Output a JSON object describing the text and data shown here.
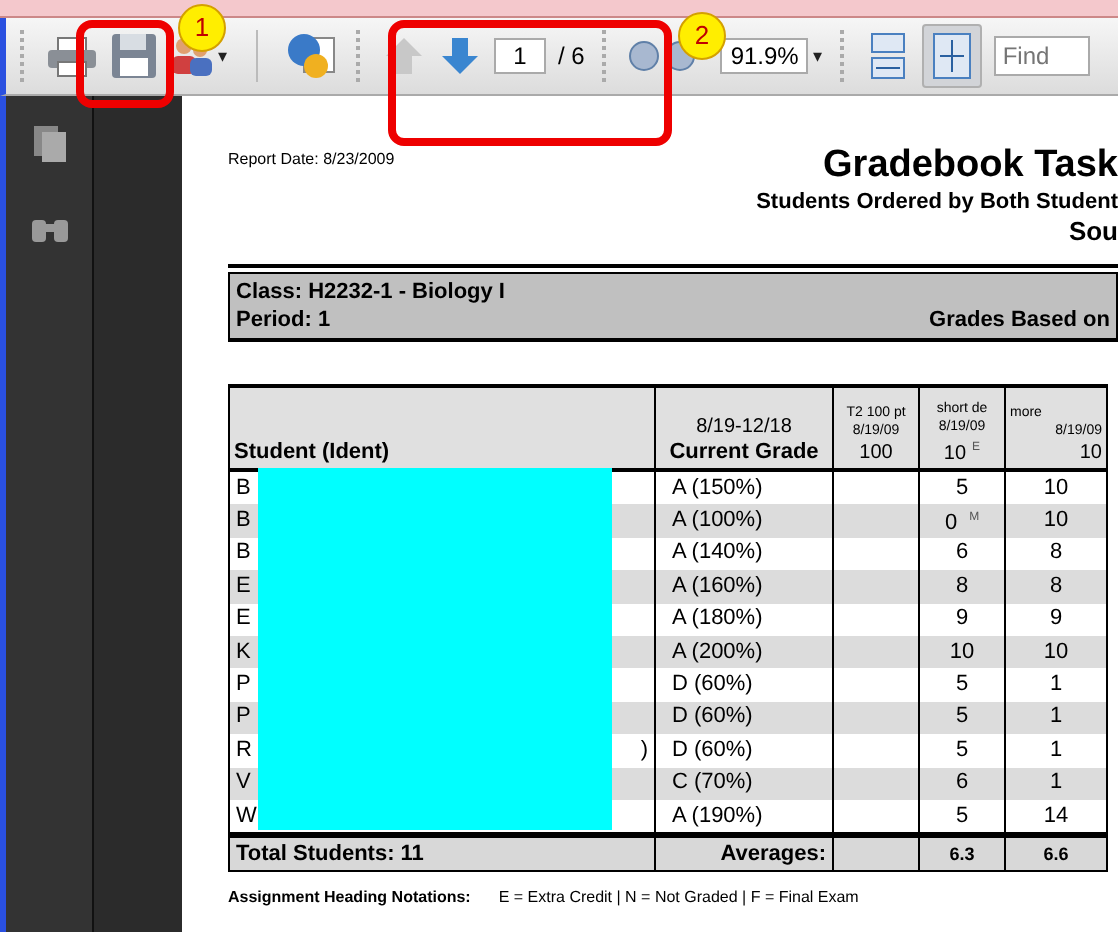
{
  "toolbar": {
    "people_caret": "▾",
    "zoom_caret": "▾",
    "page_field": "1",
    "page_total": "/ 6",
    "zoom_field": "91.9%",
    "find_placeholder": "Find",
    "fit_page_selected": true,
    "up_disabled": true
  },
  "callouts": [
    {
      "number": "1"
    },
    {
      "number": "2"
    }
  ],
  "report": {
    "report_date": "Report Date: 8/23/2009",
    "title": "Gradebook Task",
    "subtitle": "Students Ordered by Both Student",
    "subtitle_2": "Sou",
    "class_line": "Class: H2232-1 - Biology I",
    "period_line": "Period: 1",
    "grades_based": "Grades Based on"
  },
  "table": {
    "columns": [
      {
        "lines": [
          "Student (Ident)"
        ]
      },
      {
        "lines": [
          "8/19-12/18",
          "Current Grade"
        ]
      },
      {
        "lines": [
          "T2 100 pt",
          "8/19/09",
          "100"
        ]
      },
      {
        "lines": [
          "short de",
          "8/19/09",
          "10"
        ],
        "mark": "E"
      },
      {
        "lines": [
          "more",
          "8/19/09",
          "10"
        ]
      }
    ],
    "rows": [
      {
        "student": "B",
        "grade": "A  (150%)",
        "t2": "",
        "short": "5",
        "more": "10"
      },
      {
        "student": "B",
        "grade": "A  (100%)",
        "t2": "",
        "short": "0",
        "short_mark": "M",
        "more": "10"
      },
      {
        "student": "B",
        "grade": "A  (140%)",
        "t2": "",
        "short": "6",
        "more": "8"
      },
      {
        "student": "E",
        "grade": "A  (160%)",
        "t2": "",
        "short": "8",
        "more": "8"
      },
      {
        "student": "E",
        "grade": "A  (180%)",
        "t2": "",
        "short": "9",
        "more": "9"
      },
      {
        "student": "K",
        "grade": "A  (200%)",
        "t2": "",
        "short": "10",
        "more": "10"
      },
      {
        "student": "P",
        "grade": "D  (60%)",
        "t2": "",
        "short": "5",
        "more": "1"
      },
      {
        "student": "P",
        "grade": "D  (60%)",
        "t2": "",
        "short": "5",
        "more": "1"
      },
      {
        "student": "R",
        "student_tail": ")",
        "grade": "D  (60%)",
        "t2": "",
        "short": "5",
        "more": "1"
      },
      {
        "student": "V",
        "grade": "C  (70%)",
        "t2": "",
        "short": "6",
        "more": "1"
      },
      {
        "student": "W",
        "grade": "A  (190%)",
        "t2": "",
        "short": "5",
        "more": "14"
      }
    ],
    "total": "Total Students: 11",
    "averages_label": "Averages:",
    "averages": [
      "6.3",
      "6.6"
    ]
  },
  "notations": {
    "label": "Assignment Heading Notations:",
    "text": "E = Extra Credit | N = Not Graded | F = Final Exam"
  }
}
